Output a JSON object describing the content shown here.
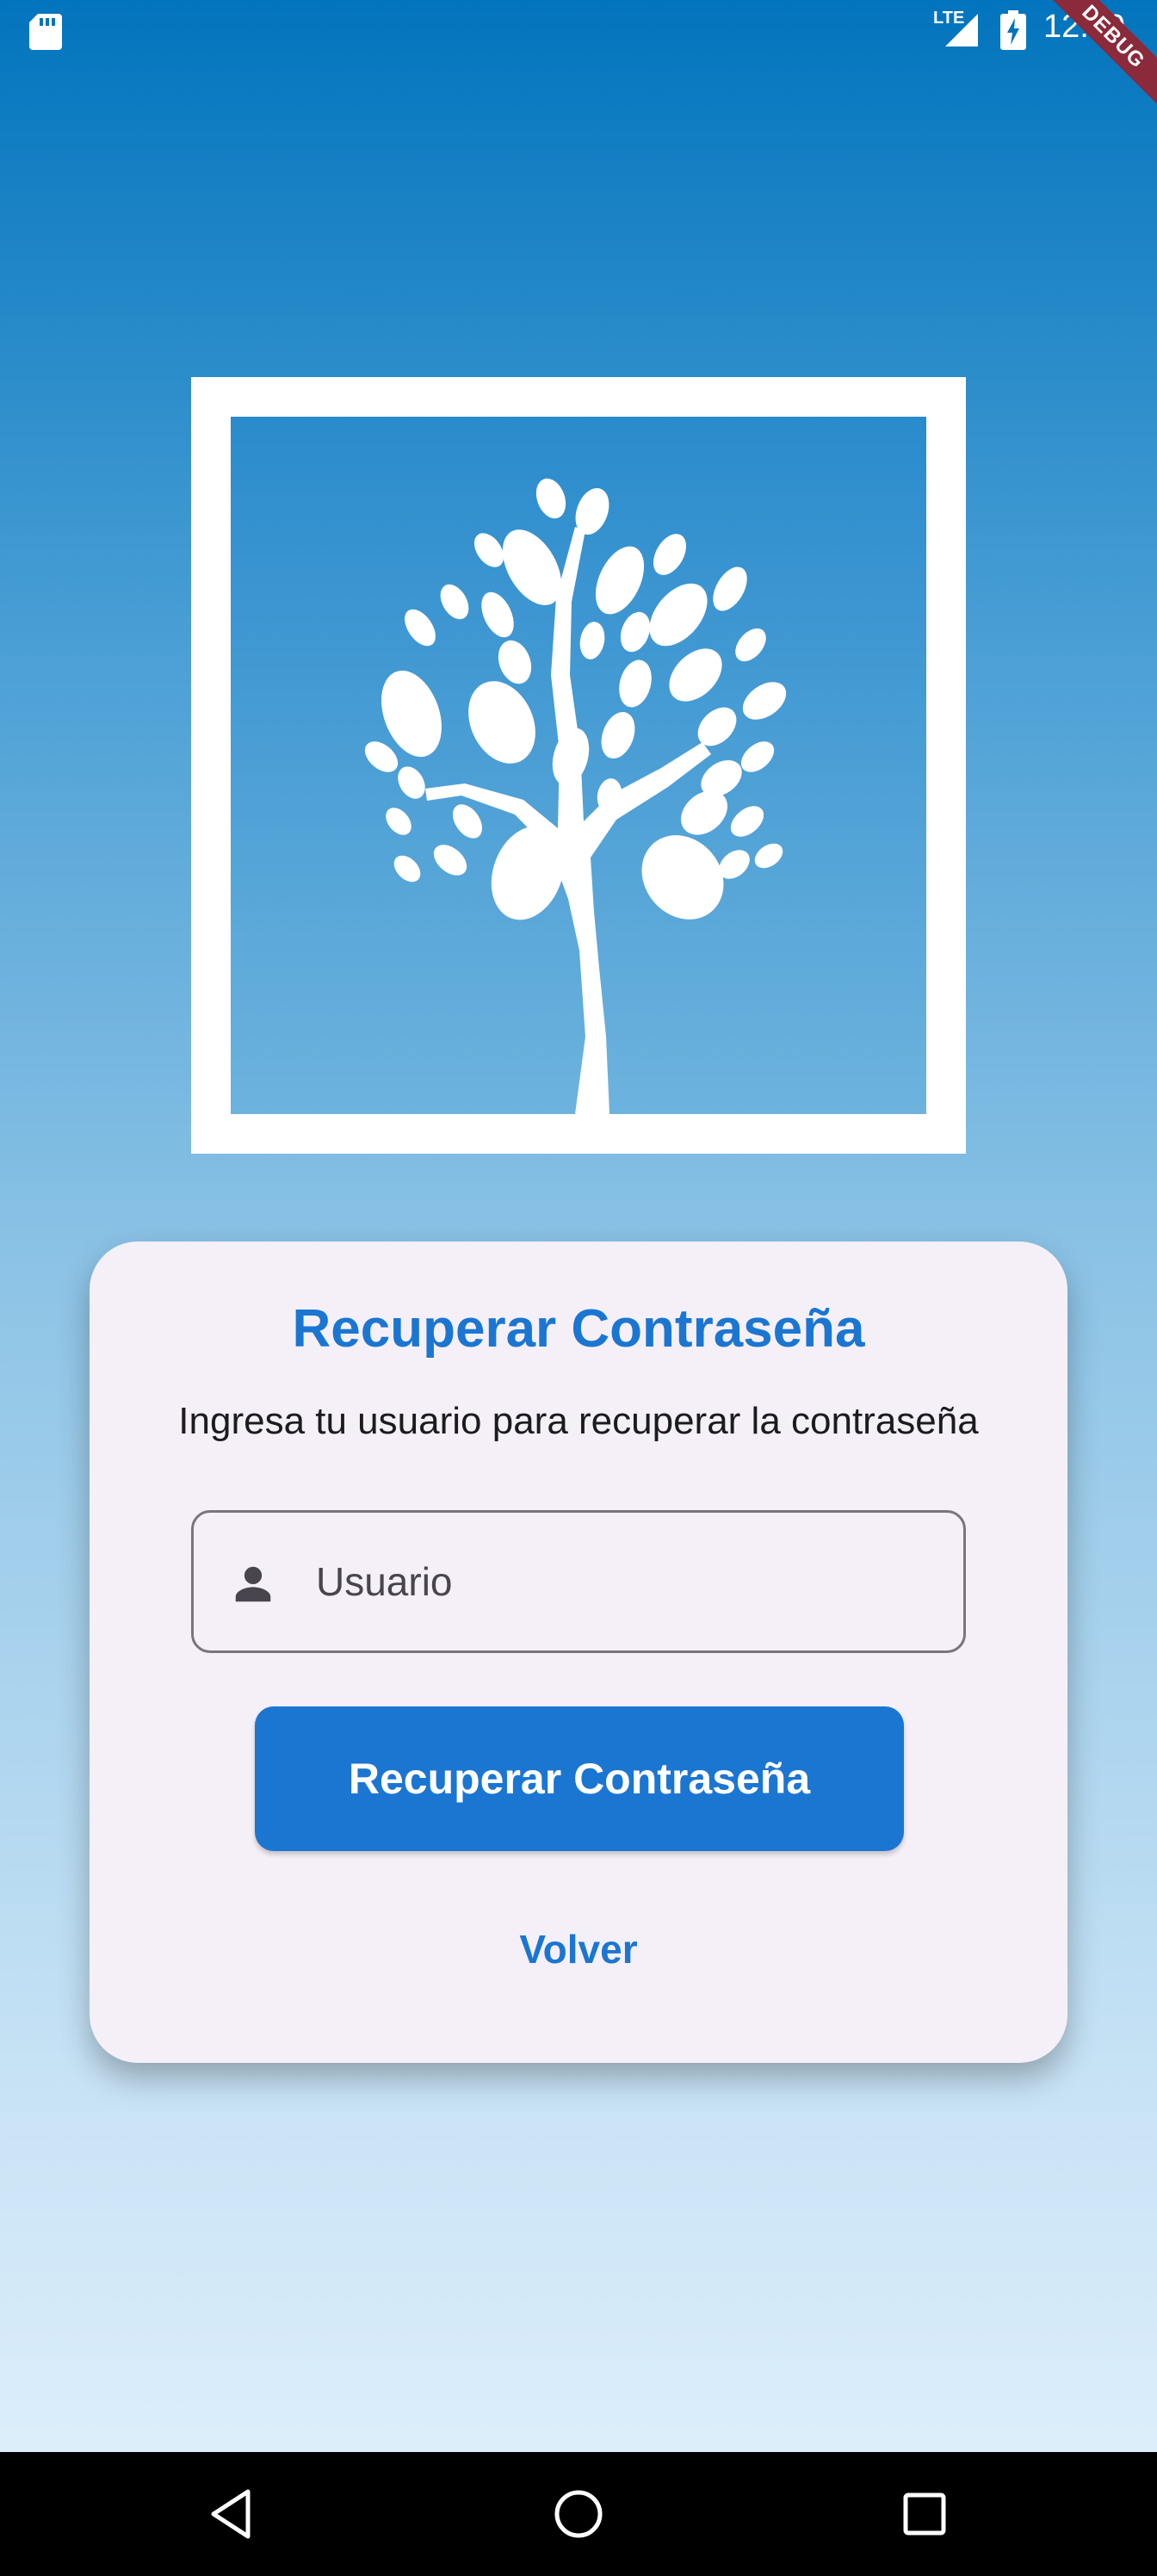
{
  "status_bar": {
    "network_label": "LTE",
    "time": "12:29",
    "debug_banner": "DEBUG",
    "icons": [
      "sd-card-icon",
      "signal-icon",
      "battery-charging-icon"
    ]
  },
  "logo": {
    "icon": "tree-logo",
    "border_color": "#ffffff"
  },
  "card": {
    "title": "Recuperar Contraseña",
    "subtitle": "Ingresa tu usuario para recuperar la contraseña",
    "username_field": {
      "icon": "person-icon",
      "placeholder": "Usuario",
      "value": ""
    },
    "submit_label": "Recuperar Contraseña",
    "back_label": "Volver"
  },
  "nav_bar": {
    "buttons": [
      "back",
      "home",
      "recents"
    ]
  },
  "colors": {
    "accent": "#1b76d2",
    "card_background": "#f5f0f8",
    "gradient_top": "#0274bd",
    "gradient_bottom": "#e3f2fc"
  }
}
